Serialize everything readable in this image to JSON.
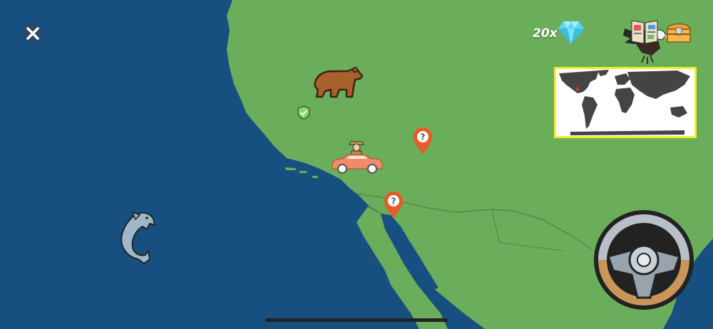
{
  "hud": {
    "gem_count": "20x",
    "close_icon": "close-icon",
    "gem_icon": "diamond-icon",
    "book_icon": "book-icon",
    "chest_icon": "treasure-chest-icon",
    "eagle_icon": "eagle-icon"
  },
  "map": {
    "ocean_color": "#174f80",
    "land_color": "#6aad5a",
    "icons": [
      "bear-icon",
      "shield-check-icon",
      "question-pin-icon",
      "question-pin-icon",
      "car-explorer-icon",
      "dolphin-icon",
      "steering-wheel-icon"
    ],
    "pins": [
      {
        "label": "?"
      },
      {
        "label": "?"
      }
    ]
  },
  "minimap": {
    "background": "#ffffff",
    "border_color": "#f2ee29",
    "land_color": "#444444",
    "marker_color": "#e53030"
  }
}
